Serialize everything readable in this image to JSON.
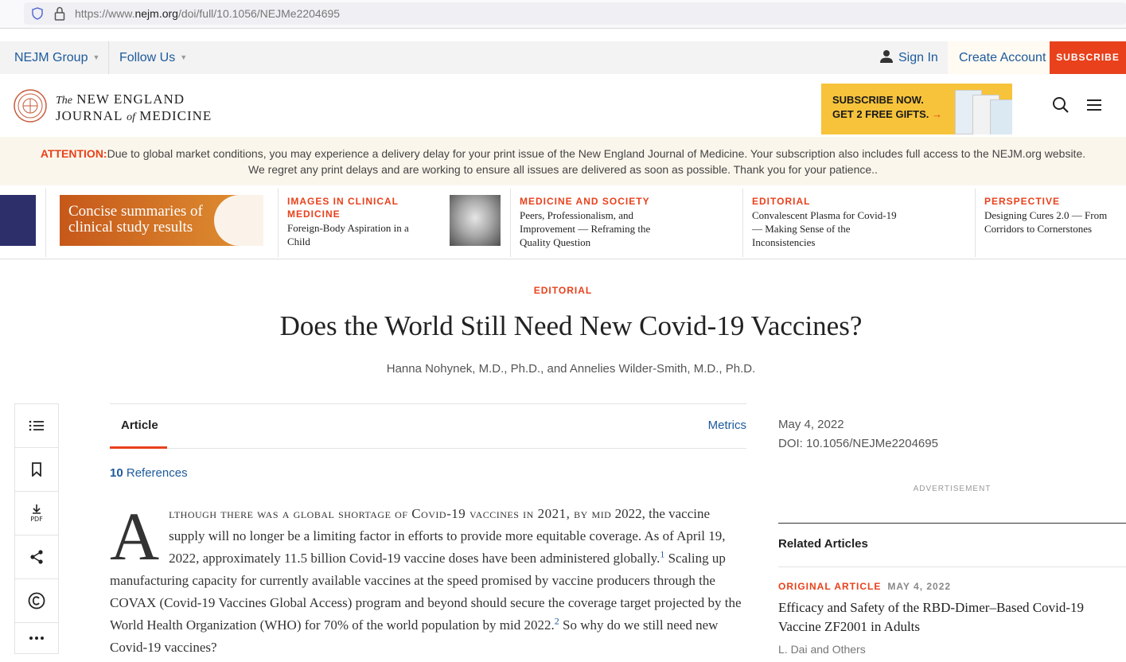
{
  "browser": {
    "url_prefix": "https://www.",
    "url_domain": "nejm.org",
    "url_path": "/doi/full/10.1056/NEJMe2204695"
  },
  "utility": {
    "group": "NEJM Group",
    "follow": "Follow Us",
    "sign_in": "Sign In",
    "create_account": "Create Account",
    "subscribe": "SUBSCRIBE"
  },
  "masthead": {
    "logo_the": "The",
    "logo_line1": "NEW ENGLAND",
    "logo_journal": "JOURNAL",
    "logo_of": "of",
    "logo_medicine": "MEDICINE",
    "promo_line1": "SUBSCRIBE NOW.",
    "promo_line2": "GET 2 FREE GIFTS.",
    "promo_arrow": "→"
  },
  "attention": {
    "label": "ATTENTION:",
    "text": "Due to global market conditions, you may experience a delivery delay for your print issue of the New England Journal of Medicine. Your subscription also includes full access to the NEJM.org website. We regret any print delays and are working to ensure all issues are delivered as soon as possible. Thank you for your patience.."
  },
  "carousel": {
    "banner_text": "Concise summaries of clinical study results",
    "items": [
      {
        "category": "IMAGES IN CLINICAL MEDICINE",
        "title": "Foreign-Body Aspiration in a Child"
      },
      {
        "category": "MEDICINE AND SOCIETY",
        "title": "Peers, Professionalism, and Improvement — Reframing the Quality Question"
      },
      {
        "category": "EDITORIAL",
        "title": "Convalescent Plasma for Covid-19 — Making Sense of the Inconsistencies"
      },
      {
        "category": "PERSPECTIVE",
        "title": "Designing Cures 2.0 — From Corridors to Cornerstones"
      }
    ]
  },
  "article": {
    "category": "EDITORIAL",
    "title": "Does the World Still Need New Covid-19 Vaccines?",
    "authors": "Hanna Nohynek, M.D., Ph.D., and Annelies Wilder-Smith, M.D., Ph.D.",
    "tab_article": "Article",
    "tab_metrics": "Metrics",
    "ref_count": "10",
    "ref_label": "References",
    "dropcap": "A",
    "lead_smallcaps": "lthough there was a global shortage of Covid-19 vaccines in 2021, by mid",
    "text_1": " 2022, the vaccine supply will no longer be a limiting factor in efforts to provide more equitable coverage. As of April 19, 2022, approximately 11.5 billion Covid-19 vaccine doses have been administered globally.",
    "sup_1": "1",
    "text_2": " Scaling up manufacturing capacity for currently available vaccines at the speed promised by vaccine producers through the COVAX (Covid-19 Vaccines Global Access) program and beyond should secure the coverage target projected by the World Health Organization (WHO) for 70% of the world population by mid 2022.",
    "sup_2": "2",
    "text_3": " So why do we still need new Covid-19 vaccines?"
  },
  "sidebar": {
    "date": "May 4, 2022",
    "doi": "DOI: 10.1056/NEJMe2204695",
    "advertisement": "ADVERTISEMENT",
    "related_heading": "Related Articles",
    "related": {
      "category": "ORIGINAL ARTICLE",
      "date": "MAY 4, 2022",
      "title": "Efficacy and Safety of the RBD-Dimer–Based Covid-19 Vaccine ZF2001 in Adults",
      "authors": "L. Dai and Others"
    }
  },
  "tools": [
    "contents-icon",
    "bookmark-icon",
    "pdf-download-icon",
    "share-icon",
    "copyright-icon",
    "more-icon"
  ],
  "colors": {
    "accent": "#e8411c",
    "link": "#1d5a9c",
    "promo": "#f6c33b",
    "attention_bg": "#fbf6ec"
  }
}
